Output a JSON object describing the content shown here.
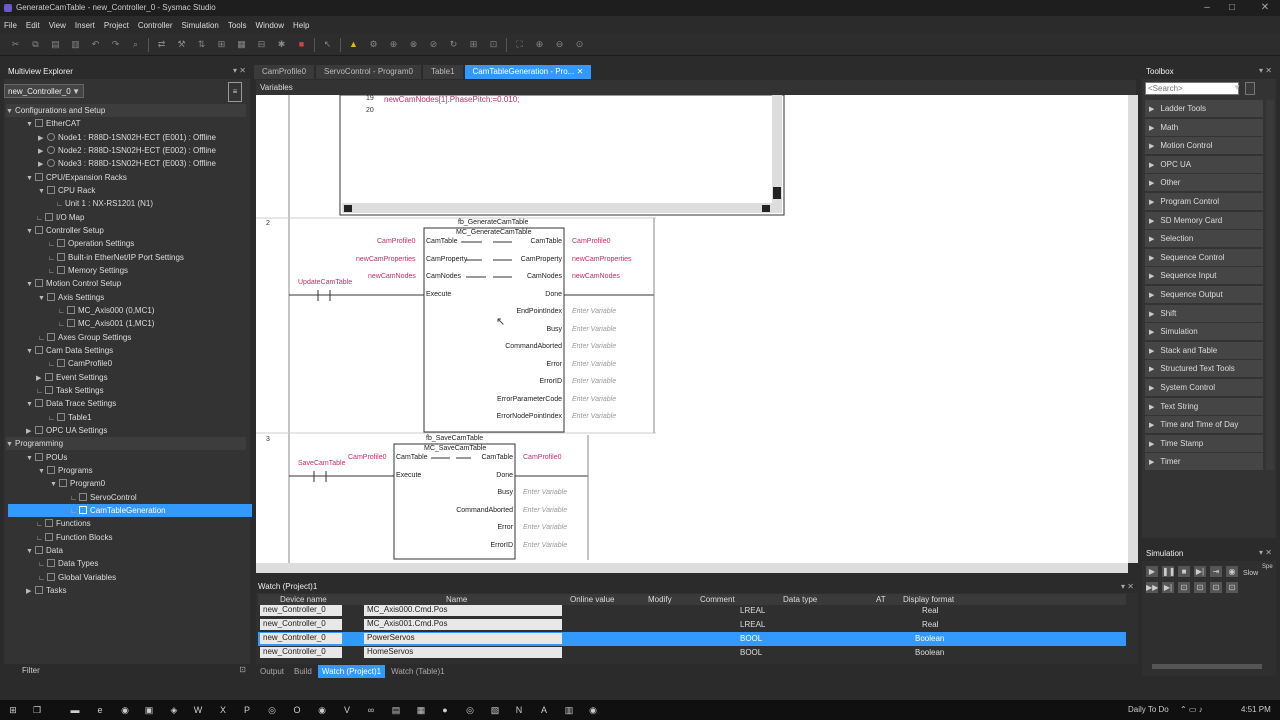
{
  "window": {
    "title": "GenerateCamTable - new_Controller_0 - Sysmac Studio"
  },
  "menu": [
    "File",
    "Edit",
    "View",
    "Insert",
    "Project",
    "Controller",
    "Simulation",
    "Tools",
    "Window",
    "Help"
  ],
  "explorer": {
    "title": "Multiview Explorer",
    "controller": "new_Controller_0",
    "filter_label": "Filter",
    "tree": [
      {
        "label": "Configurations and Setup",
        "section": true
      },
      {
        "label": "EtherCAT"
      },
      {
        "label": "Node1 : R88D-1SN02H-ECT (E001) : Offline"
      },
      {
        "label": "Node2 : R88D-1SN02H-ECT (E002) : Offline"
      },
      {
        "label": "Node3 : R88D-1SN02H-ECT (E003) : Offline"
      },
      {
        "label": "CPU/Expansion Racks"
      },
      {
        "label": "CPU Rack"
      },
      {
        "label": "Unit 1 : NX-RS1201 (N1)"
      },
      {
        "label": "I/O Map"
      },
      {
        "label": "Controller Setup"
      },
      {
        "label": "Operation Settings"
      },
      {
        "label": "Built-in EtherNet/IP Port Settings"
      },
      {
        "label": "Memory Settings"
      },
      {
        "label": "Motion Control Setup"
      },
      {
        "label": "Axis Settings"
      },
      {
        "label": "MC_Axis000 (0,MC1)"
      },
      {
        "label": "MC_Axis001 (1,MC1)"
      },
      {
        "label": "Axes Group Settings"
      },
      {
        "label": "Cam Data Settings"
      },
      {
        "label": "CamProfile0"
      },
      {
        "label": "Event Settings"
      },
      {
        "label": "Task Settings"
      },
      {
        "label": "Data Trace Settings"
      },
      {
        "label": "Table1"
      },
      {
        "label": "OPC UA Settings"
      },
      {
        "label": "Programming",
        "section": true
      },
      {
        "label": "POUs"
      },
      {
        "label": "Programs"
      },
      {
        "label": "Program0"
      },
      {
        "label": "ServoControl"
      },
      {
        "label": "CamTableGeneration",
        "selected": true
      },
      {
        "label": "Functions"
      },
      {
        "label": "Function Blocks"
      },
      {
        "label": "Data"
      },
      {
        "label": "Data Types"
      },
      {
        "label": "Global Variables"
      },
      {
        "label": "Tasks"
      }
    ]
  },
  "editor": {
    "tabs": [
      {
        "label": "CamProfile0",
        "active": false
      },
      {
        "label": "ServoControl - Program0",
        "active": false
      },
      {
        "label": "Table1",
        "active": false
      },
      {
        "label": "CamTableGeneration - Pro...",
        "active": true
      }
    ],
    "variables_label": "Variables",
    "st_lines": [
      {
        "num": "19",
        "code": "newCamNodes[1].PhasePitch:=0.010;"
      },
      {
        "num": "20",
        "code": ""
      }
    ],
    "rung2": {
      "num": "2",
      "instance": "fb_GenerateCamTable",
      "fb_name": "MC_GenerateCamTable",
      "contact": "UpdateCamTable",
      "inputs": [
        {
          "pin": "CamTable",
          "var": "CamProfile0"
        },
        {
          "pin": "CamProperty",
          "var": "newCamProperties"
        },
        {
          "pin": "CamNodes",
          "var": "newCamNodes"
        },
        {
          "pin": "Execute",
          "var": ""
        }
      ],
      "outputs": [
        {
          "pin": "CamTable",
          "var": "CamProfile0",
          "placeholder": false
        },
        {
          "pin": "CamProperty",
          "var": "newCamProperties",
          "placeholder": false
        },
        {
          "pin": "CamNodes",
          "var": "newCamNodes",
          "placeholder": false
        },
        {
          "pin": "Done",
          "var": "",
          "placeholder": false
        },
        {
          "pin": "EndPointIndex",
          "var": "Enter Variable",
          "placeholder": true
        },
        {
          "pin": "Busy",
          "var": "Enter Variable",
          "placeholder": true
        },
        {
          "pin": "CommandAborted",
          "var": "Enter Variable",
          "placeholder": true
        },
        {
          "pin": "Error",
          "var": "Enter Variable",
          "placeholder": true
        },
        {
          "pin": "ErrorID",
          "var": "Enter Variable",
          "placeholder": true
        },
        {
          "pin": "ErrorParameterCode",
          "var": "Enter Variable",
          "placeholder": true
        },
        {
          "pin": "ErrorNodePointIndex",
          "var": "Enter Variable",
          "placeholder": true
        }
      ]
    },
    "rung3": {
      "num": "3",
      "instance": "fb_SaveCamTable",
      "fb_name": "MC_SaveCamTable",
      "contact": "SaveCamTable",
      "inputs": [
        {
          "pin": "CamTable",
          "var": "CamProfile0"
        },
        {
          "pin": "Execute",
          "var": ""
        }
      ],
      "outputs": [
        {
          "pin": "CamTable",
          "var": "CamProfile0",
          "placeholder": false
        },
        {
          "pin": "Done",
          "var": "",
          "placeholder": false
        },
        {
          "pin": "Busy",
          "var": "Enter Variable",
          "placeholder": true
        },
        {
          "pin": "CommandAborted",
          "var": "Enter Variable",
          "placeholder": true
        },
        {
          "pin": "Error",
          "var": "Enter Variable",
          "placeholder": true
        },
        {
          "pin": "ErrorID",
          "var": "Enter Variable",
          "placeholder": true
        }
      ]
    }
  },
  "toolbox": {
    "title": "Toolbox",
    "search_placeholder": "<Search>",
    "items": [
      "Ladder Tools",
      "Math",
      "Motion Control",
      "OPC UA",
      "Other",
      "Program Control",
      "SD Memory Card",
      "Selection",
      "Sequence Control",
      "Sequence Input",
      "Sequence Output",
      "Shift",
      "Simulation",
      "Stack and Table",
      "Structured Text Tools",
      "System Control",
      "Text String",
      "Time and Time of Day",
      "Time Stamp",
      "Timer"
    ]
  },
  "simulation": {
    "title": "Simulation",
    "slow_label": "Slow",
    "speed_label": "Spe"
  },
  "watch": {
    "title": "Watch (Project)1",
    "columns": [
      "Device name",
      "Name",
      "Online value",
      "Modify",
      "Comment",
      "Data type",
      "AT",
      "Display format"
    ],
    "rows": [
      {
        "device": "new_Controller_0",
        "name": "MC_Axis000.Cmd.Pos",
        "type": "LREAL",
        "format": "Real",
        "selected": false
      },
      {
        "device": "new_Controller_0",
        "name": "MC_Axis001.Cmd.Pos",
        "type": "LREAL",
        "format": "Real",
        "selected": false
      },
      {
        "device": "new_Controller_0",
        "name": "PowerServos",
        "type": "BOOL",
        "format": "Boolean",
        "selected": true
      },
      {
        "device": "new_Controller_0",
        "name": "HomeServos",
        "type": "BOOL",
        "format": "Boolean",
        "selected": false
      }
    ],
    "bottom_tabs": [
      {
        "label": "Output",
        "active": false
      },
      {
        "label": "Build",
        "active": false
      },
      {
        "label": "Watch (Project)1",
        "active": true
      },
      {
        "label": "Watch (Table)1",
        "active": false
      }
    ]
  },
  "taskbar": {
    "daily": "Daily To Do",
    "time": "4:51 PM"
  }
}
